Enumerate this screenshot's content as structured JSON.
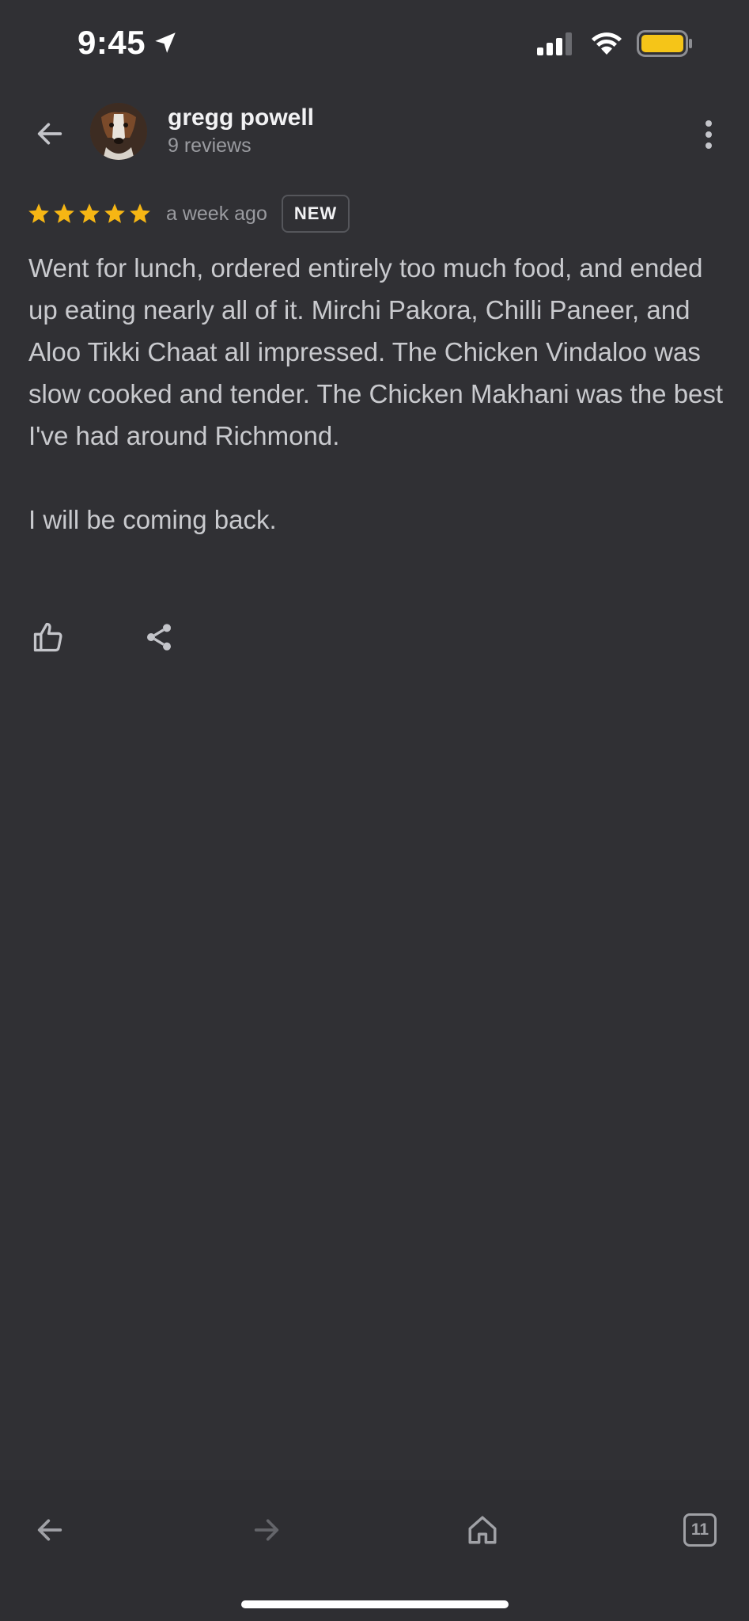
{
  "status_bar": {
    "time": "9:45",
    "icons": [
      "location-arrow-icon",
      "cellular-signal-icon",
      "wifi-icon",
      "battery-icon"
    ],
    "battery_color": "#f5c518"
  },
  "header": {
    "back_icon": "arrow-left-icon",
    "user_name": "gregg powell",
    "review_count": "9 reviews",
    "more_icon": "more-vertical-icon"
  },
  "review": {
    "rating": 5,
    "star_color": "#f6b614",
    "time_ago": "a week ago",
    "badge": "NEW",
    "paragraphs": [
      "Went for lunch, ordered entirely too much food, and ended up eating nearly all of it. Mirchi Pakora, Chilli Paneer, and Aloo Tikki Chaat all impressed. The Chicken Vindaloo was slow cooked and tender. The Chicken Makhani was the best I've had around Richmond.",
      "I will be coming back."
    ],
    "actions": [
      "thumbs-up-icon",
      "share-icon"
    ]
  },
  "bottom_bar": {
    "back_icon": "arrow-left-icon",
    "forward_icon": "arrow-right-icon",
    "home_icon": "home-icon",
    "tabs_count": "11"
  }
}
